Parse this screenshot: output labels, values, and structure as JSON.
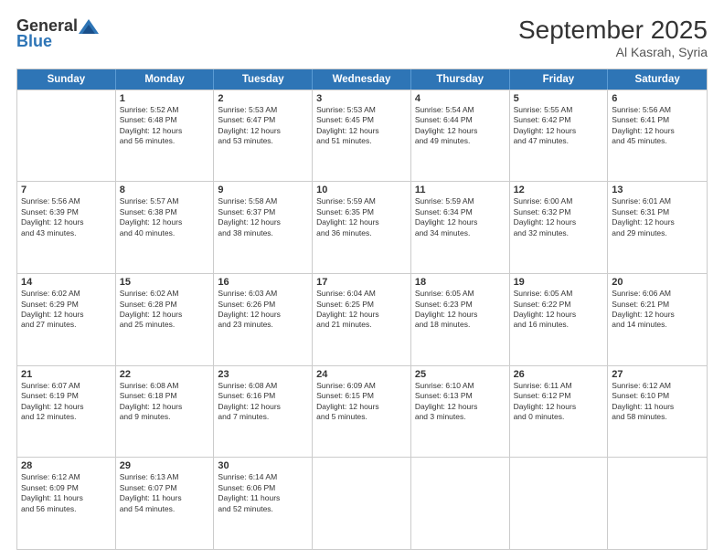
{
  "header": {
    "logo_general": "General",
    "logo_blue": "Blue",
    "month": "September 2025",
    "location": "Al Kasrah, Syria"
  },
  "days_of_week": [
    "Sunday",
    "Monday",
    "Tuesday",
    "Wednesday",
    "Thursday",
    "Friday",
    "Saturday"
  ],
  "weeks": [
    [
      {
        "day": "",
        "info": ""
      },
      {
        "day": "1",
        "info": "Sunrise: 5:52 AM\nSunset: 6:48 PM\nDaylight: 12 hours\nand 56 minutes."
      },
      {
        "day": "2",
        "info": "Sunrise: 5:53 AM\nSunset: 6:47 PM\nDaylight: 12 hours\nand 53 minutes."
      },
      {
        "day": "3",
        "info": "Sunrise: 5:53 AM\nSunset: 6:45 PM\nDaylight: 12 hours\nand 51 minutes."
      },
      {
        "day": "4",
        "info": "Sunrise: 5:54 AM\nSunset: 6:44 PM\nDaylight: 12 hours\nand 49 minutes."
      },
      {
        "day": "5",
        "info": "Sunrise: 5:55 AM\nSunset: 6:42 PM\nDaylight: 12 hours\nand 47 minutes."
      },
      {
        "day": "6",
        "info": "Sunrise: 5:56 AM\nSunset: 6:41 PM\nDaylight: 12 hours\nand 45 minutes."
      }
    ],
    [
      {
        "day": "7",
        "info": "Sunrise: 5:56 AM\nSunset: 6:39 PM\nDaylight: 12 hours\nand 43 minutes."
      },
      {
        "day": "8",
        "info": "Sunrise: 5:57 AM\nSunset: 6:38 PM\nDaylight: 12 hours\nand 40 minutes."
      },
      {
        "day": "9",
        "info": "Sunrise: 5:58 AM\nSunset: 6:37 PM\nDaylight: 12 hours\nand 38 minutes."
      },
      {
        "day": "10",
        "info": "Sunrise: 5:59 AM\nSunset: 6:35 PM\nDaylight: 12 hours\nand 36 minutes."
      },
      {
        "day": "11",
        "info": "Sunrise: 5:59 AM\nSunset: 6:34 PM\nDaylight: 12 hours\nand 34 minutes."
      },
      {
        "day": "12",
        "info": "Sunrise: 6:00 AM\nSunset: 6:32 PM\nDaylight: 12 hours\nand 32 minutes."
      },
      {
        "day": "13",
        "info": "Sunrise: 6:01 AM\nSunset: 6:31 PM\nDaylight: 12 hours\nand 29 minutes."
      }
    ],
    [
      {
        "day": "14",
        "info": "Sunrise: 6:02 AM\nSunset: 6:29 PM\nDaylight: 12 hours\nand 27 minutes."
      },
      {
        "day": "15",
        "info": "Sunrise: 6:02 AM\nSunset: 6:28 PM\nDaylight: 12 hours\nand 25 minutes."
      },
      {
        "day": "16",
        "info": "Sunrise: 6:03 AM\nSunset: 6:26 PM\nDaylight: 12 hours\nand 23 minutes."
      },
      {
        "day": "17",
        "info": "Sunrise: 6:04 AM\nSunset: 6:25 PM\nDaylight: 12 hours\nand 21 minutes."
      },
      {
        "day": "18",
        "info": "Sunrise: 6:05 AM\nSunset: 6:23 PM\nDaylight: 12 hours\nand 18 minutes."
      },
      {
        "day": "19",
        "info": "Sunrise: 6:05 AM\nSunset: 6:22 PM\nDaylight: 12 hours\nand 16 minutes."
      },
      {
        "day": "20",
        "info": "Sunrise: 6:06 AM\nSunset: 6:21 PM\nDaylight: 12 hours\nand 14 minutes."
      }
    ],
    [
      {
        "day": "21",
        "info": "Sunrise: 6:07 AM\nSunset: 6:19 PM\nDaylight: 12 hours\nand 12 minutes."
      },
      {
        "day": "22",
        "info": "Sunrise: 6:08 AM\nSunset: 6:18 PM\nDaylight: 12 hours\nand 9 minutes."
      },
      {
        "day": "23",
        "info": "Sunrise: 6:08 AM\nSunset: 6:16 PM\nDaylight: 12 hours\nand 7 minutes."
      },
      {
        "day": "24",
        "info": "Sunrise: 6:09 AM\nSunset: 6:15 PM\nDaylight: 12 hours\nand 5 minutes."
      },
      {
        "day": "25",
        "info": "Sunrise: 6:10 AM\nSunset: 6:13 PM\nDaylight: 12 hours\nand 3 minutes."
      },
      {
        "day": "26",
        "info": "Sunrise: 6:11 AM\nSunset: 6:12 PM\nDaylight: 12 hours\nand 0 minutes."
      },
      {
        "day": "27",
        "info": "Sunrise: 6:12 AM\nSunset: 6:10 PM\nDaylight: 11 hours\nand 58 minutes."
      }
    ],
    [
      {
        "day": "28",
        "info": "Sunrise: 6:12 AM\nSunset: 6:09 PM\nDaylight: 11 hours\nand 56 minutes."
      },
      {
        "day": "29",
        "info": "Sunrise: 6:13 AM\nSunset: 6:07 PM\nDaylight: 11 hours\nand 54 minutes."
      },
      {
        "day": "30",
        "info": "Sunrise: 6:14 AM\nSunset: 6:06 PM\nDaylight: 11 hours\nand 52 minutes."
      },
      {
        "day": "",
        "info": ""
      },
      {
        "day": "",
        "info": ""
      },
      {
        "day": "",
        "info": ""
      },
      {
        "day": "",
        "info": ""
      }
    ]
  ]
}
